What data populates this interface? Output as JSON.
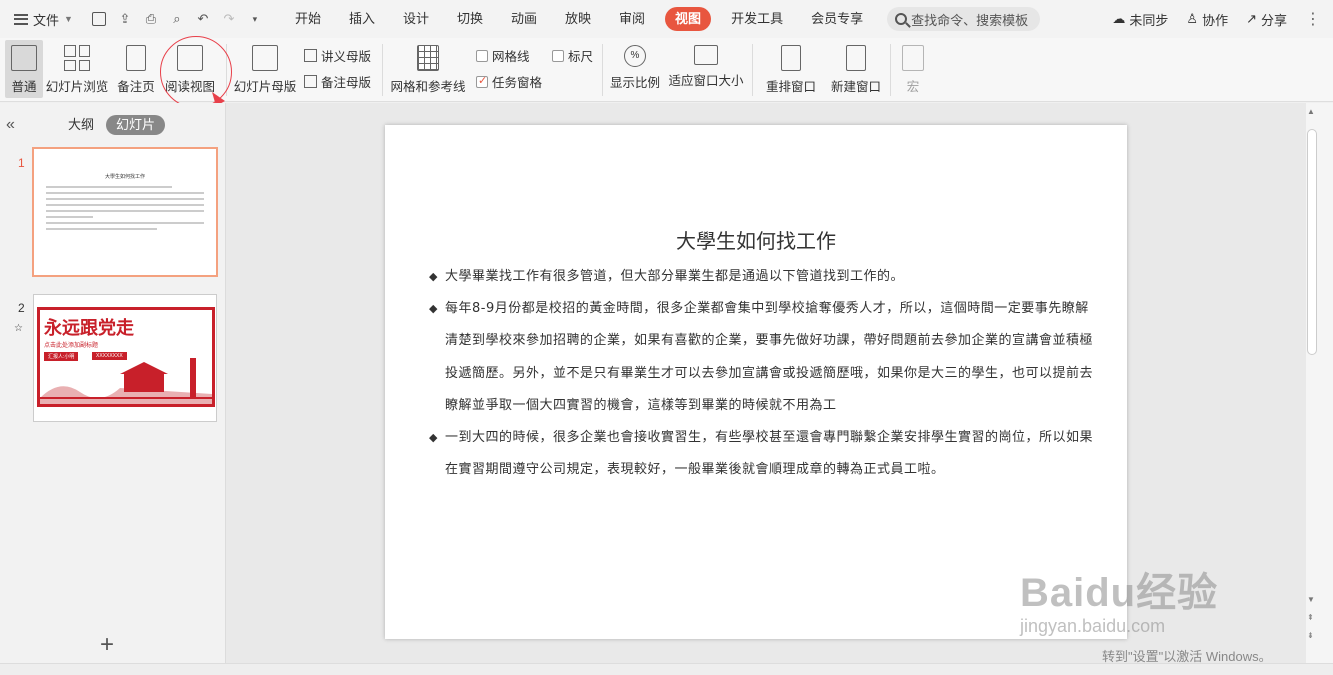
{
  "menubar": {
    "file_label": "文件",
    "tabs": [
      "开始",
      "插入",
      "设计",
      "切换",
      "动画",
      "放映",
      "审阅",
      "视图",
      "开发工具",
      "会员专享"
    ],
    "active_tab": "视图",
    "search_placeholder": "查找命令、搜索模板",
    "sync_label": "未同步",
    "collab_label": "协作",
    "share_label": "分享"
  },
  "ribbon": {
    "normal": "普通",
    "slide_sorter": "幻灯片浏览",
    "notes_page": "备注页",
    "reading_view": "阅读视图",
    "slide_master": "幻灯片母版",
    "handout_master": "讲义母版",
    "notes_master": "备注母版",
    "grid_guides": "网格和参考线",
    "gridlines": "网格线",
    "ruler": "标尺",
    "task_pane": "任务窗格",
    "zoom": "显示比例",
    "fit_window": "适应窗口大小",
    "arrange_window": "重排窗口",
    "new_window": "新建窗口",
    "macro": "宏"
  },
  "left_panel": {
    "outline_tab": "大纲",
    "slides_tab": "幻灯片",
    "slide1_number": "1",
    "slide2_number": "2",
    "thumb1_title": "大學生如何找工作",
    "thumb2_title": "永远跟党走",
    "thumb2_sub": "点击此处添加副标题",
    "thumb2_tag1": "汇报人:小明",
    "thumb2_tag2": "XXXXXXXX"
  },
  "slide": {
    "title": "大學生如何找工作",
    "bullets": [
      "大學畢業找工作有很多管道，但大部分畢業生都是通過以下管道找到工作的。",
      "每年8-9月份都是校招的黃金時間，很多企業都會集中到學校搶奪優秀人才，所以，這個時間一定要事先瞭解清楚到學校來參加招聘的企業，如果有喜歡的企業，要事先做好功課，帶好問題前去參加企業的宣講會並積極投遞簡歷。另外，並不是只有畢業生才可以去參加宣講會或投遞簡歷哦，如果你是大三的學生，也可以提前去瞭解並爭取一個大四實習的機會，這樣等到畢業的時候就不用為工",
      "一到大四的時候，很多企業也會接收實習生，有些學校甚至還會專門聯繫企業安排學生實習的崗位，所以如果在實習期間遵守公司規定，表現較好，一般畢業後就會順理成章的轉為正式員工啦。"
    ]
  },
  "overlay": {
    "watermark": "Baidu经验",
    "watermark_url": "jingyan.baidu.com",
    "activate_text": "转到\"设置\"以激活 Windows。"
  },
  "colors": {
    "accent": "#e8563f",
    "annotation": "#e8404a"
  }
}
